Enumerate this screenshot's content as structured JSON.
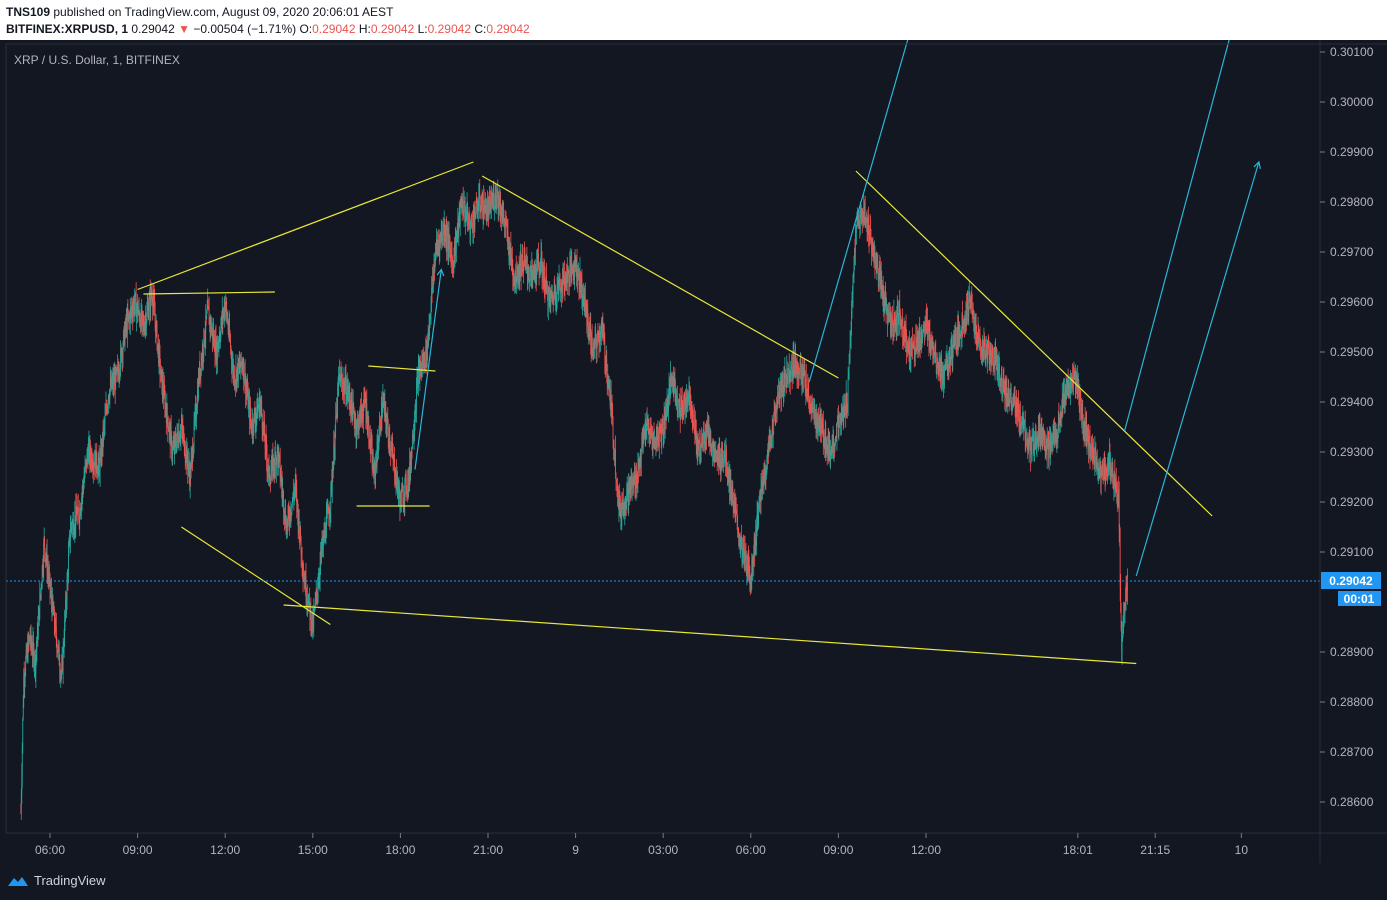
{
  "header": {
    "author": "TNS109",
    "published_text": "published on TradingView.com, August 09, 2020 20:06:01 AEST",
    "symbol": "BITFINEX:XRPUSD",
    "interval": "1",
    "last_price": "0.29042",
    "change": "−0.00504 (−1.71%)",
    "o_label": "O:",
    "o_value": "0.29042",
    "h_label": "H:",
    "h_value": "0.29042",
    "l_label": "L:",
    "l_value": "0.29042",
    "c_label": "C:",
    "c_value": "0.29042"
  },
  "chart_title": "XRP / U.S. Dollar, 1, BITFINEX",
  "price_tag": "0.29042",
  "countdown": "00:01",
  "footer": {
    "brand": "TradingView"
  },
  "colors": {
    "background": "#131722",
    "up": "#26a69a",
    "down": "#ef5350",
    "trendline": "#e8e838",
    "channel": "#29b6d6",
    "price_line": "#2196f3"
  },
  "chart_data": {
    "type": "candlestick",
    "title": "XRP / U.S. Dollar, 1, BITFINEX",
    "ylim": [
      0.2852,
      0.3015
    ],
    "y_ticks": [
      "0.30100",
      "0.30000",
      "0.29900",
      "0.29800",
      "0.29700",
      "0.29600",
      "0.29500",
      "0.29400",
      "0.29300",
      "0.29200",
      "0.29100",
      "0.29042",
      "0.28900",
      "0.28800",
      "0.28700",
      "0.28600"
    ],
    "x_ticks": [
      {
        "label": "06:00",
        "h": 3
      },
      {
        "label": "09:00",
        "h": 6
      },
      {
        "label": "12:00",
        "h": 9
      },
      {
        "label": "15:00",
        "h": 12
      },
      {
        "label": "18:00",
        "h": 15
      },
      {
        "label": "21:00",
        "h": 18
      },
      {
        "label": "9",
        "h": 21
      },
      {
        "label": "03:00",
        "h": 24
      },
      {
        "label": "06:00",
        "h": 27
      },
      {
        "label": "09:00",
        "h": 30
      },
      {
        "label": "12:00",
        "h": 33
      },
      {
        "label": "18:01",
        "h": 38.2
      },
      {
        "label": "21:15",
        "h": 40.85
      },
      {
        "label": "10",
        "h": 43.8
      }
    ],
    "last_price": 0.29042,
    "price_path": [
      [
        2.0,
        0.2858
      ],
      [
        2.1,
        0.2885
      ],
      [
        2.3,
        0.2893
      ],
      [
        2.5,
        0.2888
      ],
      [
        2.8,
        0.2912
      ],
      [
        3.1,
        0.2898
      ],
      [
        3.4,
        0.2885
      ],
      [
        3.7,
        0.2915
      ],
      [
        4.0,
        0.2918
      ],
      [
        4.3,
        0.293
      ],
      [
        4.7,
        0.2927
      ],
      [
        5.0,
        0.2942
      ],
      [
        5.3,
        0.2945
      ],
      [
        5.6,
        0.2955
      ],
      [
        5.9,
        0.296
      ],
      [
        6.2,
        0.2955
      ],
      [
        6.5,
        0.2962
      ],
      [
        6.8,
        0.2945
      ],
      [
        7.2,
        0.293
      ],
      [
        7.5,
        0.2935
      ],
      [
        7.8,
        0.2925
      ],
      [
        8.1,
        0.2945
      ],
      [
        8.4,
        0.2958
      ],
      [
        8.7,
        0.295
      ],
      [
        9.0,
        0.296
      ],
      [
        9.3,
        0.2945
      ],
      [
        9.6,
        0.2948
      ],
      [
        9.9,
        0.2935
      ],
      [
        10.2,
        0.294
      ],
      [
        10.5,
        0.2925
      ],
      [
        10.8,
        0.293
      ],
      [
        11.1,
        0.2915
      ],
      [
        11.4,
        0.2923
      ],
      [
        11.7,
        0.2905
      ],
      [
        12.0,
        0.2895
      ],
      [
        12.3,
        0.291
      ],
      [
        12.6,
        0.292
      ],
      [
        12.9,
        0.2945
      ],
      [
        13.2,
        0.2942
      ],
      [
        13.5,
        0.2935
      ],
      [
        13.8,
        0.294
      ],
      [
        14.1,
        0.2925
      ],
      [
        14.4,
        0.294
      ],
      [
        14.7,
        0.293
      ],
      [
        15.0,
        0.292
      ],
      [
        15.3,
        0.2925
      ],
      [
        15.6,
        0.2945
      ],
      [
        15.9,
        0.295
      ],
      [
        16.2,
        0.297
      ],
      [
        16.5,
        0.2975
      ],
      [
        16.8,
        0.2968
      ],
      [
        17.1,
        0.298
      ],
      [
        17.4,
        0.2975
      ],
      [
        17.7,
        0.298
      ],
      [
        18.0,
        0.2978
      ],
      [
        18.3,
        0.2982
      ],
      [
        18.6,
        0.2975
      ],
      [
        18.9,
        0.2965
      ],
      [
        19.2,
        0.2968
      ],
      [
        19.5,
        0.2965
      ],
      [
        19.8,
        0.2968
      ],
      [
        20.1,
        0.296
      ],
      [
        20.4,
        0.2963
      ],
      [
        20.7,
        0.2965
      ],
      [
        21.0,
        0.2968
      ],
      [
        21.3,
        0.296
      ],
      [
        21.6,
        0.295
      ],
      [
        21.9,
        0.2955
      ],
      [
        22.2,
        0.294
      ],
      [
        22.5,
        0.2918
      ],
      [
        22.8,
        0.2922
      ],
      [
        23.1,
        0.2925
      ],
      [
        23.4,
        0.2935
      ],
      [
        23.7,
        0.2932
      ],
      [
        24.0,
        0.2935
      ],
      [
        24.3,
        0.2945
      ],
      [
        24.6,
        0.2938
      ],
      [
        24.9,
        0.2942
      ],
      [
        25.2,
        0.293
      ],
      [
        25.5,
        0.2935
      ],
      [
        25.8,
        0.2928
      ],
      [
        26.1,
        0.293
      ],
      [
        26.4,
        0.292
      ],
      [
        26.7,
        0.291
      ],
      [
        27.0,
        0.2905
      ],
      [
        27.3,
        0.292
      ],
      [
        27.6,
        0.293
      ],
      [
        27.9,
        0.294
      ],
      [
        28.2,
        0.2945
      ],
      [
        28.5,
        0.2948
      ],
      [
        28.8,
        0.2945
      ],
      [
        29.1,
        0.2938
      ],
      [
        29.4,
        0.2935
      ],
      [
        29.7,
        0.293
      ],
      [
        30.0,
        0.2935
      ],
      [
        30.3,
        0.294
      ],
      [
        30.6,
        0.2975
      ],
      [
        30.9,
        0.2978
      ],
      [
        31.2,
        0.297
      ],
      [
        31.5,
        0.2962
      ],
      [
        31.8,
        0.2955
      ],
      [
        32.1,
        0.2958
      ],
      [
        32.4,
        0.295
      ],
      [
        32.7,
        0.2952
      ],
      [
        33.0,
        0.2955
      ],
      [
        33.3,
        0.295
      ],
      [
        33.6,
        0.2945
      ],
      [
        33.9,
        0.295
      ],
      [
        34.2,
        0.2955
      ],
      [
        34.5,
        0.296
      ],
      [
        34.8,
        0.2952
      ],
      [
        35.1,
        0.295
      ],
      [
        35.4,
        0.2948
      ],
      [
        35.7,
        0.2942
      ],
      [
        36.0,
        0.294
      ],
      [
        36.3,
        0.2935
      ],
      [
        36.6,
        0.293
      ],
      [
        36.9,
        0.2935
      ],
      [
        37.2,
        0.293
      ],
      [
        37.5,
        0.2935
      ],
      [
        37.8,
        0.2942
      ],
      [
        38.1,
        0.2945
      ],
      [
        38.4,
        0.2935
      ],
      [
        38.7,
        0.293
      ],
      [
        39.0,
        0.2925
      ],
      [
        39.3,
        0.2928
      ],
      [
        39.6,
        0.292
      ],
      [
        39.7,
        0.289
      ],
      [
        39.8,
        0.29
      ],
      [
        39.9,
        0.29042
      ]
    ],
    "drawings": [
      {
        "kind": "trendline",
        "color": "yellow",
        "points": [
          [
            6.0,
            0.29625
          ],
          [
            17.5,
            0.2988
          ]
        ]
      },
      {
        "kind": "trendline",
        "color": "yellow",
        "points": [
          [
            6.2,
            0.29616
          ],
          [
            10.7,
            0.2962
          ]
        ]
      },
      {
        "kind": "trendline",
        "color": "yellow",
        "points": [
          [
            7.5,
            0.2915
          ],
          [
            12.6,
            0.28955
          ]
        ]
      },
      {
        "kind": "trendline",
        "color": "yellow",
        "points": [
          [
            11.0,
            0.28994
          ],
          [
            40.2,
            0.28877
          ]
        ]
      },
      {
        "kind": "trendline",
        "color": "yellow",
        "points": [
          [
            13.9,
            0.29472
          ],
          [
            16.2,
            0.29462
          ]
        ]
      },
      {
        "kind": "trendline",
        "color": "yellow",
        "points": [
          [
            13.5,
            0.29192
          ],
          [
            16.0,
            0.29192
          ]
        ]
      },
      {
        "kind": "trendline",
        "color": "yellow",
        "points": [
          [
            17.8,
            0.29852
          ],
          [
            30.0,
            0.29448
          ]
        ]
      },
      {
        "kind": "trendline",
        "color": "yellow",
        "points": [
          [
            30.6,
            0.29862
          ],
          [
            42.8,
            0.29172
          ]
        ]
      },
      {
        "kind": "channel",
        "color": "cyan",
        "points": [
          [
            29.0,
            0.2944
          ],
          [
            32.5,
            0.3015
          ]
        ]
      },
      {
        "kind": "channel",
        "color": "cyan",
        "points": [
          [
            39.8,
            0.29342
          ],
          [
            43.5,
            0.3015
          ]
        ]
      },
      {
        "kind": "arrow",
        "color": "cyan",
        "points": [
          [
            15.5,
            0.29265
          ],
          [
            16.4,
            0.29665
          ]
        ]
      },
      {
        "kind": "arrow",
        "color": "cyan",
        "points": [
          [
            40.2,
            0.29052
          ],
          [
            44.4,
            0.2988
          ]
        ]
      }
    ]
  }
}
